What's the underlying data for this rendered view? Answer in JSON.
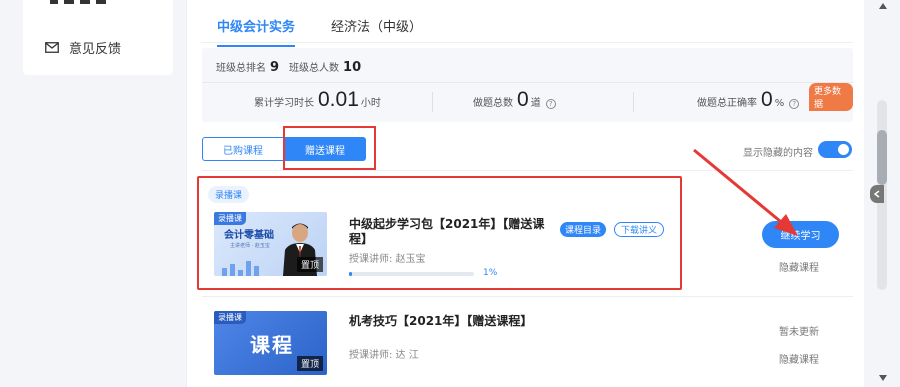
{
  "sidebar": {
    "feedback_label": "意见反馈"
  },
  "tabs": [
    {
      "label": "中级会计实务",
      "active": true
    },
    {
      "label": "经济法（中级）",
      "active": false
    }
  ],
  "stats": {
    "class_rank_label": "班级总排名",
    "class_rank_value": "9",
    "class_total_label": "班级总人数",
    "class_total_value": "10",
    "study_time_label": "累计学习时长",
    "study_time_value": "0.01",
    "study_time_unit": "小时",
    "questions_label": "做题总数",
    "questions_value": "0",
    "questions_unit": "道",
    "accuracy_label": "做题总正确率",
    "accuracy_value": "0",
    "accuracy_unit": "%",
    "more_badge": "更多数据"
  },
  "sub_tabs": {
    "purchased": "已购课程",
    "gift": "赠送课程"
  },
  "show_hidden_label": "显示隐藏的内容",
  "courses": [
    {
      "type_tag": "录播课",
      "thumb_corner": "录播课",
      "thumb_title": "会计零基础",
      "thumb_sub": "主讲老师 · 赵玉宝",
      "pin_label": "置顶",
      "title": "中级起步学习包【2021年】【赠送课程】",
      "catalog_label": "课程目录",
      "download_label": "下载讲义",
      "teacher": "授课讲师:  赵玉宝",
      "progress": 0.01,
      "progress_label": "1%",
      "continue_label": "继续学习",
      "hide_label": "隐藏课程"
    },
    {
      "thumb_corner": "录播课",
      "thumb_big": "课程",
      "pin_label": "置顶",
      "title": "机考技巧【2021年】【赠送课程】",
      "teacher": "授课讲师:  达  江",
      "status_label": "暂未更新",
      "hide_label": "隐藏课程"
    }
  ],
  "colors": {
    "accent": "#2f86f6",
    "highlight_red": "#e53935",
    "badge_orange": "#f07a45"
  }
}
